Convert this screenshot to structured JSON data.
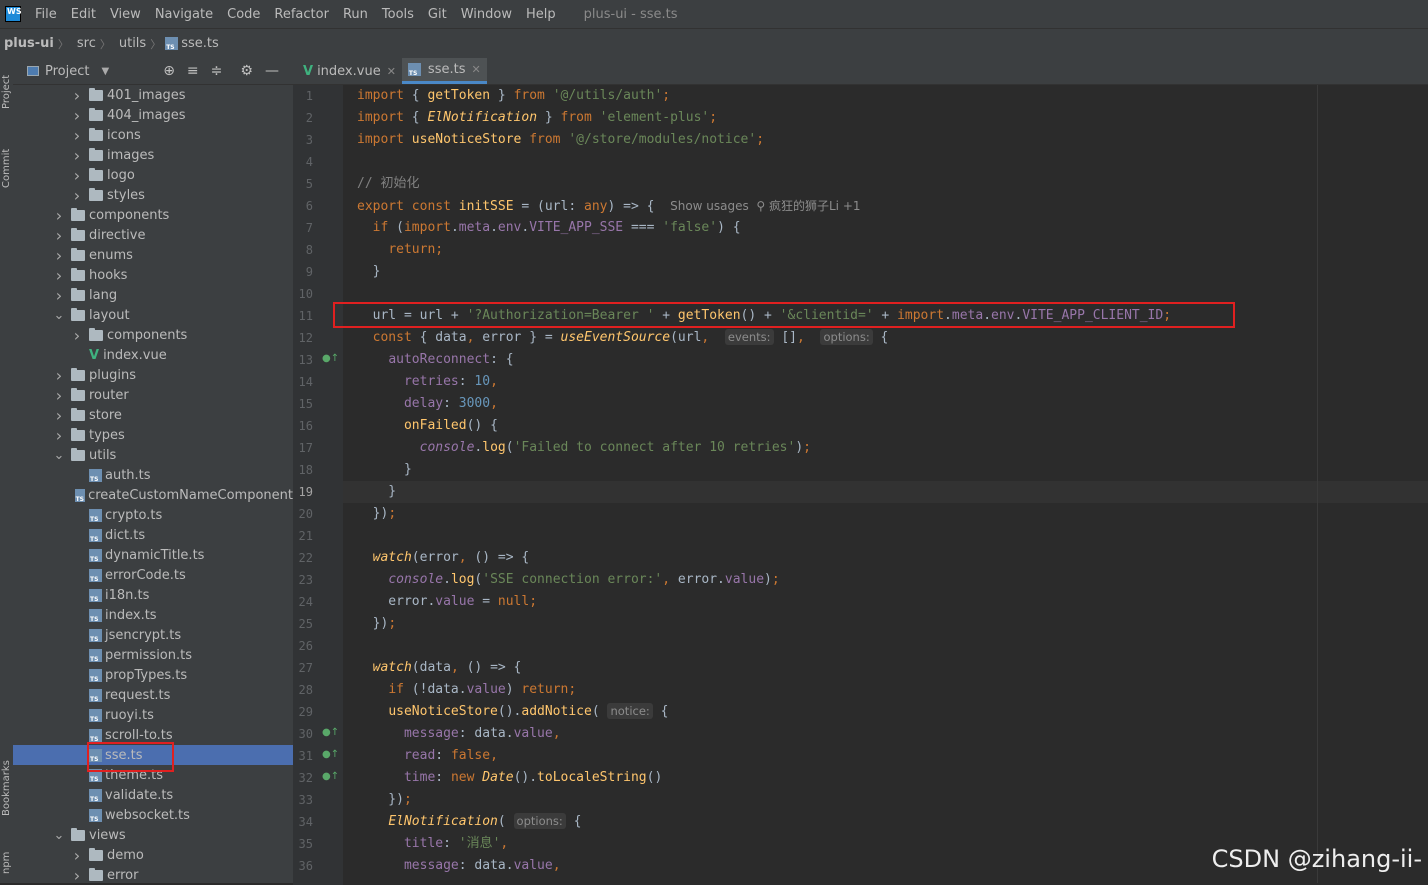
{
  "menubar": {
    "logo": "WS",
    "items": [
      "File",
      "Edit",
      "View",
      "Navigate",
      "Code",
      "Refactor",
      "Run",
      "Tools",
      "Git",
      "Window",
      "Help"
    ],
    "title": "plus-ui - sse.ts"
  },
  "breadcrumb": {
    "project": "plus-ui",
    "parts": [
      "src",
      "utils",
      "sse.ts"
    ]
  },
  "left_strip": {
    "project": "Project",
    "commit": "Commit",
    "bookmarks": "Bookmarks",
    "npm": "npm"
  },
  "project_panel": {
    "title": "Project",
    "tree": [
      {
        "label": "401_images",
        "type": "folder",
        "depth": 3,
        "expanded": false
      },
      {
        "label": "404_images",
        "type": "folder",
        "depth": 3,
        "expanded": false
      },
      {
        "label": "icons",
        "type": "folder",
        "depth": 3,
        "expanded": false
      },
      {
        "label": "images",
        "type": "folder",
        "depth": 3,
        "expanded": false
      },
      {
        "label": "logo",
        "type": "folder",
        "depth": 3,
        "expanded": false
      },
      {
        "label": "styles",
        "type": "folder",
        "depth": 3,
        "expanded": false
      },
      {
        "label": "components",
        "type": "folder",
        "depth": 2,
        "expanded": false
      },
      {
        "label": "directive",
        "type": "folder",
        "depth": 2,
        "expanded": false
      },
      {
        "label": "enums",
        "type": "folder",
        "depth": 2,
        "expanded": false
      },
      {
        "label": "hooks",
        "type": "folder",
        "depth": 2,
        "expanded": false
      },
      {
        "label": "lang",
        "type": "folder",
        "depth": 2,
        "expanded": false
      },
      {
        "label": "layout",
        "type": "folder",
        "depth": 2,
        "expanded": true
      },
      {
        "label": "components",
        "type": "folder",
        "depth": 3,
        "expanded": false
      },
      {
        "label": "index.vue",
        "type": "vue",
        "depth": 3
      },
      {
        "label": "plugins",
        "type": "folder",
        "depth": 2,
        "expanded": false
      },
      {
        "label": "router",
        "type": "folder",
        "depth": 2,
        "expanded": false
      },
      {
        "label": "store",
        "type": "folder",
        "depth": 2,
        "expanded": false
      },
      {
        "label": "types",
        "type": "folder",
        "depth": 2,
        "expanded": false
      },
      {
        "label": "utils",
        "type": "folder",
        "depth": 2,
        "expanded": true
      },
      {
        "label": "auth.ts",
        "type": "ts",
        "depth": 3
      },
      {
        "label": "createCustomNameComponent",
        "type": "ts",
        "depth": 3
      },
      {
        "label": "crypto.ts",
        "type": "ts",
        "depth": 3
      },
      {
        "label": "dict.ts",
        "type": "ts",
        "depth": 3
      },
      {
        "label": "dynamicTitle.ts",
        "type": "ts",
        "depth": 3
      },
      {
        "label": "errorCode.ts",
        "type": "ts",
        "depth": 3
      },
      {
        "label": "i18n.ts",
        "type": "ts",
        "depth": 3
      },
      {
        "label": "index.ts",
        "type": "ts",
        "depth": 3
      },
      {
        "label": "jsencrypt.ts",
        "type": "ts",
        "depth": 3
      },
      {
        "label": "permission.ts",
        "type": "ts",
        "depth": 3
      },
      {
        "label": "propTypes.ts",
        "type": "ts",
        "depth": 3
      },
      {
        "label": "request.ts",
        "type": "ts",
        "depth": 3
      },
      {
        "label": "ruoyi.ts",
        "type": "ts",
        "depth": 3
      },
      {
        "label": "scroll-to.ts",
        "type": "ts",
        "depth": 3
      },
      {
        "label": "sse.ts",
        "type": "ts",
        "depth": 3,
        "selected": true
      },
      {
        "label": "theme.ts",
        "type": "ts",
        "depth": 3
      },
      {
        "label": "validate.ts",
        "type": "ts",
        "depth": 3
      },
      {
        "label": "websocket.ts",
        "type": "ts",
        "depth": 3
      },
      {
        "label": "views",
        "type": "folder",
        "depth": 2,
        "expanded": true
      },
      {
        "label": "demo",
        "type": "folder",
        "depth": 3,
        "expanded": false
      },
      {
        "label": "error",
        "type": "folder",
        "depth": 3,
        "expanded": false
      }
    ]
  },
  "tabs": [
    {
      "label": "index.vue",
      "type": "vue",
      "active": false
    },
    {
      "label": "sse.ts",
      "type": "ts",
      "active": true
    }
  ],
  "code_lines": [
    {
      "n": 1,
      "html": "<span class=\"kw\">import</span> { <span class=\"fn\">getToken</span> } <span class=\"kw\">from</span> <span class=\"str\">'@/utils/auth'</span><span class=\"kw\">;</span>"
    },
    {
      "n": 2,
      "html": "<span class=\"kw\">import</span> { <span class=\"fn it\">ElNotification</span> } <span class=\"kw\">from</span> <span class=\"str\">'element-plus'</span><span class=\"kw\">;</span>"
    },
    {
      "n": 3,
      "html": "<span class=\"kw\">import</span> <span class=\"fn\">useNoticeStore</span> <span class=\"kw\">from</span> <span class=\"str\">'@/store/modules/notice'</span><span class=\"kw\">;</span>"
    },
    {
      "n": 4,
      "html": ""
    },
    {
      "n": 5,
      "html": "<span class=\"cmt\">// 初始化</span>"
    },
    {
      "n": 6,
      "html": "<span class=\"kw\">export const</span> <span class=\"fn\">initSSE</span> = (url: <span class=\"kw\">any</span>) => {  <span class=\"inlay\">Show usages  ⚲ 疯狂的狮子Li +1</span>"
    },
    {
      "n": 7,
      "html": "  <span class=\"kw\">if</span> (<span class=\"kw\">import</span>.<span class=\"prop\">meta</span>.<span class=\"prop\">env</span>.<span class=\"prop\">VITE_APP_SSE</span> === <span class=\"str\">'false'</span>) {"
    },
    {
      "n": 8,
      "html": "    <span class=\"kw\">return;</span>"
    },
    {
      "n": 9,
      "html": "  }"
    },
    {
      "n": 10,
      "html": ""
    },
    {
      "n": 11,
      "html": "  url = url + <span class=\"str\">'?Authorization=Bearer '</span> + <span class=\"fn\">getToken</span>() + <span class=\"str\">'&amp;clientid='</span> + <span class=\"kw\">import</span>.<span class=\"prop\">meta</span>.<span class=\"prop\">env</span>.<span class=\"prop\">VITE_APP_CLIENT_ID</span><span class=\"kw\">;</span>"
    },
    {
      "n": 12,
      "html": "  <span class=\"kw\">const</span> { data<span class=\"kw\">,</span> error } = <span class=\"fn it\">useEventSource</span>(url<span class=\"kw\">,</span>  <span class=\"hint\">events:</span> []<span class=\"kw\">,</span>  <span class=\"hint\">options:</span> {"
    },
    {
      "n": 13,
      "html": "    <span class=\"prop\">autoReconnect</span>: {"
    },
    {
      "n": 14,
      "html": "      <span class=\"prop\">retries</span>: <span class=\"num\">10</span><span class=\"kw\">,</span>"
    },
    {
      "n": 15,
      "html": "      <span class=\"prop\">delay</span>: <span class=\"num\">3000</span><span class=\"kw\">,</span>"
    },
    {
      "n": 16,
      "html": "      <span class=\"fn\">onFailed</span>() {"
    },
    {
      "n": 17,
      "html": "        <span class=\"prop it\">console</span>.<span class=\"fn\">log</span>(<span class=\"str\">'Failed to connect after 10 retries'</span>)<span class=\"kw\">;</span>"
    },
    {
      "n": 18,
      "html": "      }"
    },
    {
      "n": 19,
      "html": "    }"
    },
    {
      "n": 20,
      "html": "  })<span class=\"kw\">;</span>"
    },
    {
      "n": 21,
      "html": ""
    },
    {
      "n": 22,
      "html": "  <span class=\"fn it\">watch</span>(error<span class=\"kw\">,</span> () => {"
    },
    {
      "n": 23,
      "html": "    <span class=\"prop it\">console</span>.<span class=\"fn\">log</span>(<span class=\"str\">'SSE connection error:'</span><span class=\"kw\">,</span> error.<span class=\"prop\">value</span>)<span class=\"kw\">;</span>"
    },
    {
      "n": 24,
      "html": "    error.<span class=\"prop\">value</span> = <span class=\"kw\">null;</span>"
    },
    {
      "n": 25,
      "html": "  })<span class=\"kw\">;</span>"
    },
    {
      "n": 26,
      "html": ""
    },
    {
      "n": 27,
      "html": "  <span class=\"fn it\">watch</span>(data<span class=\"kw\">,</span> () => {"
    },
    {
      "n": 28,
      "html": "    <span class=\"kw\">if</span> (!data.<span class=\"prop\">value</span>) <span class=\"kw\">return;</span>"
    },
    {
      "n": 29,
      "html": "    <span class=\"fn\">useNoticeStore</span>().<span class=\"fn\">addNotice</span>( <span class=\"hint\">notice:</span> {"
    },
    {
      "n": 30,
      "html": "      <span class=\"prop\">message</span>: data.<span class=\"prop\">value</span><span class=\"kw\">,</span>"
    },
    {
      "n": 31,
      "html": "      <span class=\"prop\">read</span>: <span class=\"kw\">false,</span>"
    },
    {
      "n": 32,
      "html": "      <span class=\"prop\">time</span>: <span class=\"kw\">new</span> <span class=\"fn it\">Date</span>().<span class=\"fn\">toLocaleString</span>()"
    },
    {
      "n": 33,
      "html": "    })<span class=\"kw\">;</span>"
    },
    {
      "n": 34,
      "html": "    <span class=\"fn it\">ElNotification</span>( <span class=\"hint\">options:</span> {"
    },
    {
      "n": 35,
      "html": "      <span class=\"prop\">title</span>: <span class=\"str\">'消息'</span><span class=\"kw\">,</span>"
    },
    {
      "n": 36,
      "html": "      <span class=\"prop\">message</span>: data.<span class=\"prop\">value</span><span class=\"kw\">,</span>"
    }
  ],
  "gutter_marks": [
    13,
    30,
    31,
    32
  ],
  "current_line": 19,
  "highlighted_line": 11,
  "watermark": "CSDN @zihang-ii-"
}
